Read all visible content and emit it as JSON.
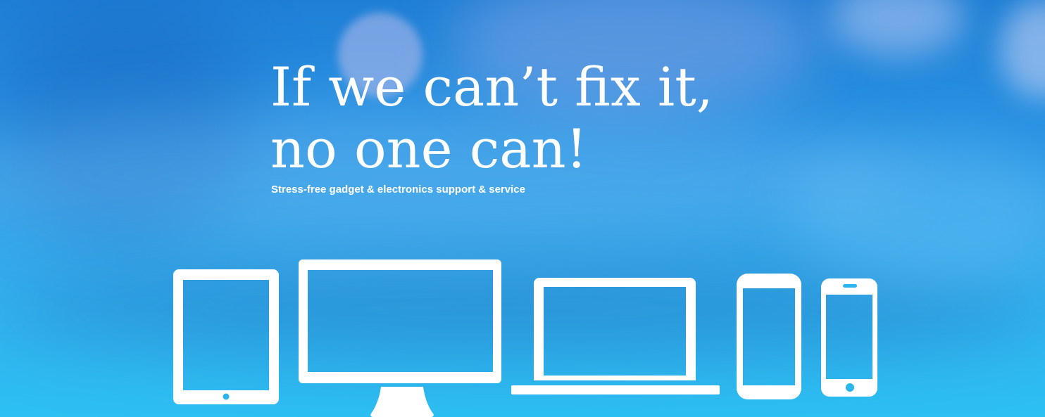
{
  "hero": {
    "headline_line1": "If we can’t fix it,",
    "headline_line2": "no one can!",
    "tagline": "Stress-free gadget & electronics support & service"
  },
  "colors": {
    "background_top": "#1f7fd6",
    "background_bottom": "#2cc0f3",
    "text": "#ffffff",
    "icon": "#ffffff"
  },
  "icons": [
    "tablet-icon",
    "desktop-monitor-icon",
    "laptop-icon",
    "android-phone-icon",
    "iphone-icon"
  ]
}
